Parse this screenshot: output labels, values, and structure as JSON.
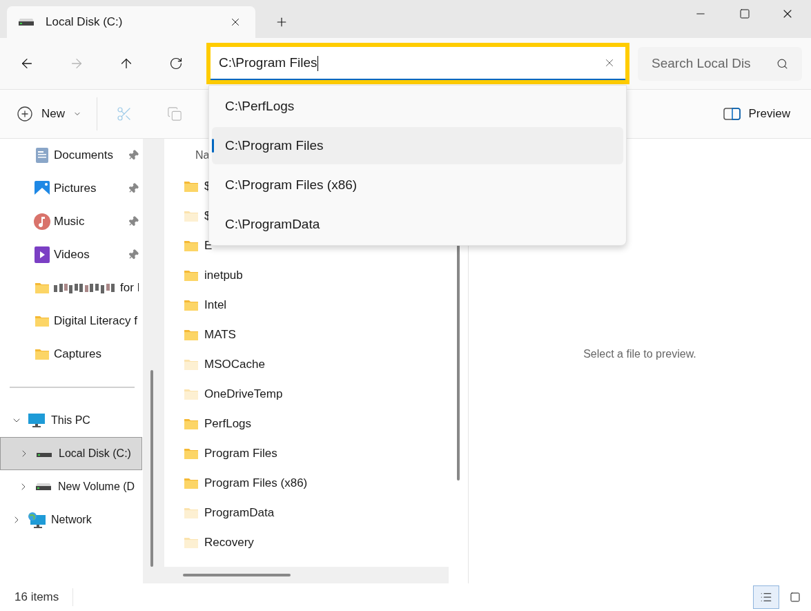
{
  "tabs": [
    {
      "title": "Local Disk (C:)",
      "selected": true
    }
  ],
  "address": {
    "value": "C:\\Program Files",
    "highlighted": true,
    "suggestions": [
      {
        "label": "C:\\PerfLogs",
        "selected": false
      },
      {
        "label": "C:\\Program Files",
        "selected": true
      },
      {
        "label": "C:\\Program Files (x86)",
        "selected": false
      },
      {
        "label": "C:\\ProgramData",
        "selected": false
      }
    ]
  },
  "search": {
    "placeholder": "Search Local Dis"
  },
  "command_bar": {
    "new_label": "New",
    "preview_label": "Preview"
  },
  "nav_pane": {
    "quick_access": [
      {
        "kind": "documents",
        "label": "Documents",
        "pinned": true,
        "obscured": false
      },
      {
        "kind": "pictures",
        "label": "Pictures",
        "pinned": true,
        "obscured": false
      },
      {
        "kind": "music",
        "label": "Music",
        "pinned": true,
        "obscured": false
      },
      {
        "kind": "videos",
        "label": "Videos",
        "pinned": true,
        "obscured": false
      },
      {
        "kind": "folder",
        "label": "for I",
        "pinned": false,
        "obscured": true
      },
      {
        "kind": "folder",
        "label": "Digital Literacy f",
        "pinned": false,
        "obscured": false
      },
      {
        "kind": "folder",
        "label": "Captures",
        "pinned": false,
        "obscured": false
      }
    ],
    "tree": [
      {
        "kind": "pc",
        "label": "This PC",
        "expanded": true,
        "selected": false,
        "children": [
          {
            "kind": "drive",
            "label": "Local Disk (C:)",
            "expanded": false,
            "selected": true
          },
          {
            "kind": "drive",
            "label": "New Volume (D",
            "expanded": false,
            "selected": false
          }
        ]
      },
      {
        "kind": "network",
        "label": "Network",
        "expanded": false,
        "selected": false
      }
    ]
  },
  "file_list": {
    "column_header": "Na",
    "rows": [
      {
        "name": "$",
        "hidden": false
      },
      {
        "name": "$",
        "hidden": true
      },
      {
        "name": "E",
        "hidden": false
      },
      {
        "name": "inetpub",
        "hidden": false
      },
      {
        "name": "Intel",
        "hidden": false
      },
      {
        "name": "MATS",
        "hidden": false
      },
      {
        "name": "MSOCache",
        "hidden": true
      },
      {
        "name": "OneDriveTemp",
        "hidden": true
      },
      {
        "name": "PerfLogs",
        "hidden": false
      },
      {
        "name": "Program Files",
        "hidden": false
      },
      {
        "name": "Program Files (x86)",
        "hidden": false
      },
      {
        "name": "ProgramData",
        "hidden": true
      },
      {
        "name": "Recovery",
        "hidden": true
      }
    ]
  },
  "preview": {
    "message": "Select a file to preview."
  },
  "status_bar": {
    "count": "16 items",
    "views": [
      {
        "kind": "details",
        "selected": true
      },
      {
        "kind": "tiles",
        "selected": false
      }
    ]
  }
}
